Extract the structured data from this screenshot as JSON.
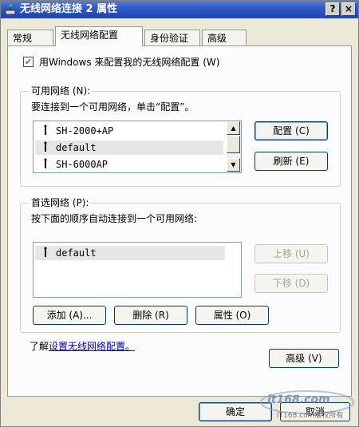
{
  "window": {
    "title": "无线网络连接 2 属性",
    "help_button": "?",
    "close_button": "×"
  },
  "tabs": [
    {
      "label": "常规"
    },
    {
      "label": "无线网络配置"
    },
    {
      "label": "身份验证"
    },
    {
      "label": "高级"
    }
  ],
  "use_windows_checkbox": {
    "label": "用Windows 来配置我的无线网络配置 (W)",
    "checked": true
  },
  "available": {
    "legend": "可用网络 (N):",
    "instruction": "要连接到一个可用网络，单击“配置”。",
    "networks": [
      "SH-2000+AP",
      "default",
      "SH-6000AP"
    ],
    "configure_button": "配置 (C)",
    "refresh_button": "刷新 (E)"
  },
  "preferred": {
    "legend": "首选网络 (P):",
    "instruction": "按下面的顺序自动连接到一个可用网络:",
    "networks": [
      "default"
    ],
    "move_up_button": "上移 (U)",
    "move_down_button": "下移 (D)",
    "add_button": "添加 (A)...",
    "remove_button": "删除 (R)",
    "properties_button": "属性 (O)"
  },
  "learn": {
    "prefix": "了解",
    "link": "设置无线网络配置。"
  },
  "advanced_button": "高级 (V)",
  "footer": {
    "ok_button": "确定",
    "cancel_button": "取消"
  },
  "watermark": {
    "logo": "it168.com",
    "caption": "IT168.com版权所有"
  }
}
